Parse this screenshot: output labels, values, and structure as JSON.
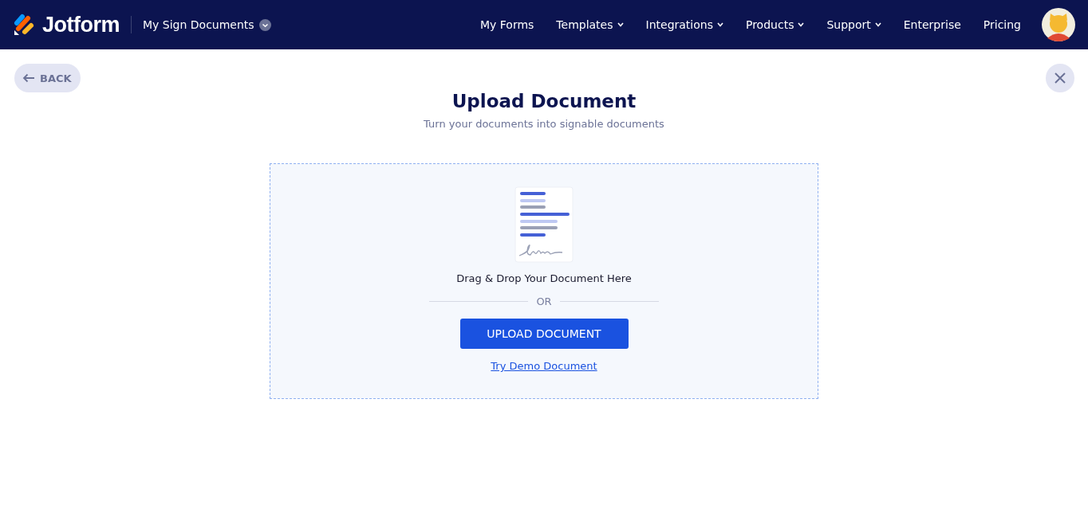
{
  "header": {
    "logo": "Jotform",
    "section": "My Sign Documents",
    "nav": [
      {
        "label": "My Forms",
        "dropdown": false
      },
      {
        "label": "Templates",
        "dropdown": true
      },
      {
        "label": "Integrations",
        "dropdown": true
      },
      {
        "label": "Products",
        "dropdown": true
      },
      {
        "label": "Support",
        "dropdown": true
      },
      {
        "label": "Enterprise",
        "dropdown": false
      },
      {
        "label": "Pricing",
        "dropdown": false
      }
    ]
  },
  "back_button": "BACK",
  "title": "Upload Document",
  "subtitle": "Turn your documents into signable documents",
  "dropzone": {
    "hint": "Drag & Drop Your Document Here",
    "separator": "OR",
    "upload_button": "UPLOAD DOCUMENT",
    "demo_link": "Try Demo Document"
  }
}
